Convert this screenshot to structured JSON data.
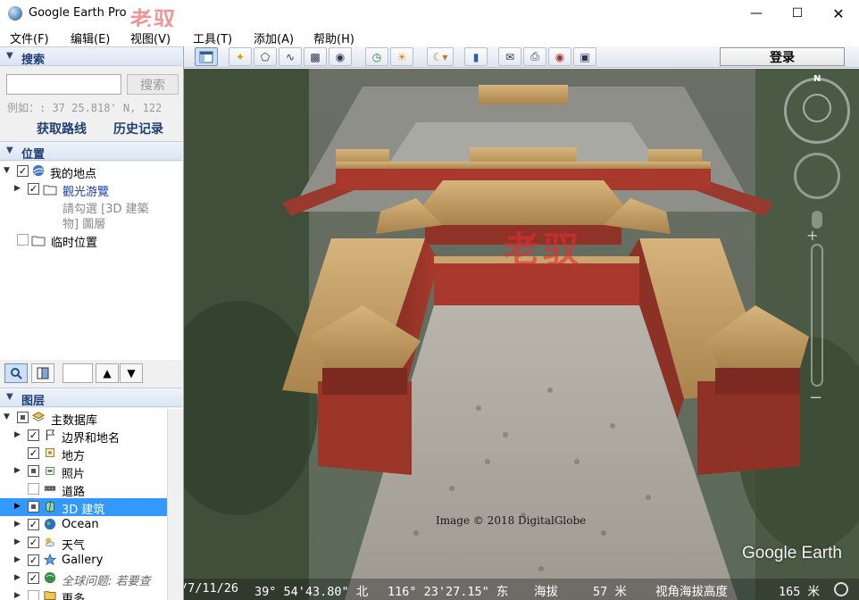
{
  "window": {
    "title": "Google Earth Pro",
    "watermark": "老驭"
  },
  "menu": [
    {
      "label": "文件(F)"
    },
    {
      "label": "编辑(E)"
    },
    {
      "label": "视图(V)"
    },
    {
      "label": "工具(T)"
    },
    {
      "label": "添加(A)"
    },
    {
      "label": "帮助(H)"
    }
  ],
  "search": {
    "header": "搜索",
    "input_value": "",
    "button": "搜索",
    "example": "例如：: 37 25.818' N, 122",
    "links": {
      "directions": "获取路线",
      "history": "历史记录"
    }
  },
  "places": {
    "header": "位置",
    "my_places": "我的地点",
    "tour": "觀光游覽",
    "tour_hint_1": "請勾選 [3D 建築",
    "tour_hint_2": "物] 圖層",
    "temp": "临时位置"
  },
  "layers": {
    "header": "图层",
    "items": [
      {
        "label": "主数据库"
      },
      {
        "label": "边界和地名"
      },
      {
        "label": "地方"
      },
      {
        "label": "照片"
      },
      {
        "label": "道路"
      },
      {
        "label": "3D 建筑"
      },
      {
        "label": "Ocean"
      },
      {
        "label": "天气"
      },
      {
        "label": "Gallery"
      },
      {
        "label": "全球问题: 若要查"
      },
      {
        "label": "更多"
      }
    ]
  },
  "toolbar": {
    "login": "登录"
  },
  "map": {
    "watermark": "老驭",
    "copyright": "Image © 2018 DigitalGlobe",
    "logo": "Google Earth",
    "compass_n": "N",
    "status": {
      "date": "/7/11/26",
      "lat": "39° 54'43.80\" 北",
      "lon": "116° 23'27.15\" 东",
      "elev_label": "海拔",
      "elev_value": "57 米",
      "eye_label": "视角海拔高度",
      "eye_value": "165 米"
    }
  },
  "colors": {
    "accent": "#1f3f75",
    "selected_row": "#3399ff",
    "roof": "#c9a56e",
    "wall": "#a83a2c"
  }
}
